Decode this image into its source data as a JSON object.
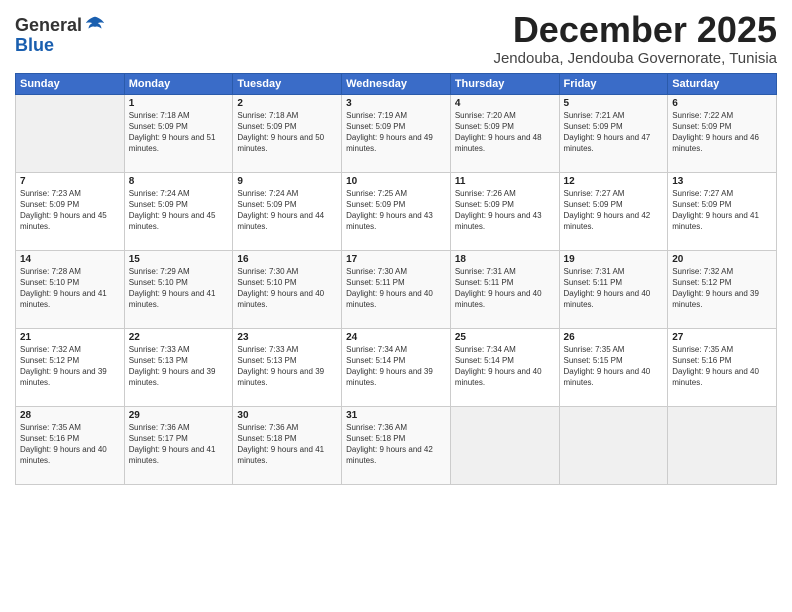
{
  "header": {
    "logo_general": "General",
    "logo_blue": "Blue",
    "month_title": "December 2025",
    "location": "Jendouba, Jendouba Governorate, Tunisia"
  },
  "days_of_week": [
    "Sunday",
    "Monday",
    "Tuesday",
    "Wednesday",
    "Thursday",
    "Friday",
    "Saturday"
  ],
  "weeks": [
    [
      {
        "day": "",
        "sunrise": "",
        "sunset": "",
        "daylight": "",
        "empty": true
      },
      {
        "day": "1",
        "sunrise": "Sunrise: 7:18 AM",
        "sunset": "Sunset: 5:09 PM",
        "daylight": "Daylight: 9 hours and 51 minutes."
      },
      {
        "day": "2",
        "sunrise": "Sunrise: 7:18 AM",
        "sunset": "Sunset: 5:09 PM",
        "daylight": "Daylight: 9 hours and 50 minutes."
      },
      {
        "day": "3",
        "sunrise": "Sunrise: 7:19 AM",
        "sunset": "Sunset: 5:09 PM",
        "daylight": "Daylight: 9 hours and 49 minutes."
      },
      {
        "day": "4",
        "sunrise": "Sunrise: 7:20 AM",
        "sunset": "Sunset: 5:09 PM",
        "daylight": "Daylight: 9 hours and 48 minutes."
      },
      {
        "day": "5",
        "sunrise": "Sunrise: 7:21 AM",
        "sunset": "Sunset: 5:09 PM",
        "daylight": "Daylight: 9 hours and 47 minutes."
      },
      {
        "day": "6",
        "sunrise": "Sunrise: 7:22 AM",
        "sunset": "Sunset: 5:09 PM",
        "daylight": "Daylight: 9 hours and 46 minutes."
      }
    ],
    [
      {
        "day": "7",
        "sunrise": "Sunrise: 7:23 AM",
        "sunset": "Sunset: 5:09 PM",
        "daylight": "Daylight: 9 hours and 45 minutes."
      },
      {
        "day": "8",
        "sunrise": "Sunrise: 7:24 AM",
        "sunset": "Sunset: 5:09 PM",
        "daylight": "Daylight: 9 hours and 45 minutes."
      },
      {
        "day": "9",
        "sunrise": "Sunrise: 7:24 AM",
        "sunset": "Sunset: 5:09 PM",
        "daylight": "Daylight: 9 hours and 44 minutes."
      },
      {
        "day": "10",
        "sunrise": "Sunrise: 7:25 AM",
        "sunset": "Sunset: 5:09 PM",
        "daylight": "Daylight: 9 hours and 43 minutes."
      },
      {
        "day": "11",
        "sunrise": "Sunrise: 7:26 AM",
        "sunset": "Sunset: 5:09 PM",
        "daylight": "Daylight: 9 hours and 43 minutes."
      },
      {
        "day": "12",
        "sunrise": "Sunrise: 7:27 AM",
        "sunset": "Sunset: 5:09 PM",
        "daylight": "Daylight: 9 hours and 42 minutes."
      },
      {
        "day": "13",
        "sunrise": "Sunrise: 7:27 AM",
        "sunset": "Sunset: 5:09 PM",
        "daylight": "Daylight: 9 hours and 41 minutes."
      }
    ],
    [
      {
        "day": "14",
        "sunrise": "Sunrise: 7:28 AM",
        "sunset": "Sunset: 5:10 PM",
        "daylight": "Daylight: 9 hours and 41 minutes."
      },
      {
        "day": "15",
        "sunrise": "Sunrise: 7:29 AM",
        "sunset": "Sunset: 5:10 PM",
        "daylight": "Daylight: 9 hours and 41 minutes."
      },
      {
        "day": "16",
        "sunrise": "Sunrise: 7:30 AM",
        "sunset": "Sunset: 5:10 PM",
        "daylight": "Daylight: 9 hours and 40 minutes."
      },
      {
        "day": "17",
        "sunrise": "Sunrise: 7:30 AM",
        "sunset": "Sunset: 5:11 PM",
        "daylight": "Daylight: 9 hours and 40 minutes."
      },
      {
        "day": "18",
        "sunrise": "Sunrise: 7:31 AM",
        "sunset": "Sunset: 5:11 PM",
        "daylight": "Daylight: 9 hours and 40 minutes."
      },
      {
        "day": "19",
        "sunrise": "Sunrise: 7:31 AM",
        "sunset": "Sunset: 5:11 PM",
        "daylight": "Daylight: 9 hours and 40 minutes."
      },
      {
        "day": "20",
        "sunrise": "Sunrise: 7:32 AM",
        "sunset": "Sunset: 5:12 PM",
        "daylight": "Daylight: 9 hours and 39 minutes."
      }
    ],
    [
      {
        "day": "21",
        "sunrise": "Sunrise: 7:32 AM",
        "sunset": "Sunset: 5:12 PM",
        "daylight": "Daylight: 9 hours and 39 minutes."
      },
      {
        "day": "22",
        "sunrise": "Sunrise: 7:33 AM",
        "sunset": "Sunset: 5:13 PM",
        "daylight": "Daylight: 9 hours and 39 minutes."
      },
      {
        "day": "23",
        "sunrise": "Sunrise: 7:33 AM",
        "sunset": "Sunset: 5:13 PM",
        "daylight": "Daylight: 9 hours and 39 minutes."
      },
      {
        "day": "24",
        "sunrise": "Sunrise: 7:34 AM",
        "sunset": "Sunset: 5:14 PM",
        "daylight": "Daylight: 9 hours and 39 minutes."
      },
      {
        "day": "25",
        "sunrise": "Sunrise: 7:34 AM",
        "sunset": "Sunset: 5:14 PM",
        "daylight": "Daylight: 9 hours and 40 minutes."
      },
      {
        "day": "26",
        "sunrise": "Sunrise: 7:35 AM",
        "sunset": "Sunset: 5:15 PM",
        "daylight": "Daylight: 9 hours and 40 minutes."
      },
      {
        "day": "27",
        "sunrise": "Sunrise: 7:35 AM",
        "sunset": "Sunset: 5:16 PM",
        "daylight": "Daylight: 9 hours and 40 minutes."
      }
    ],
    [
      {
        "day": "28",
        "sunrise": "Sunrise: 7:35 AM",
        "sunset": "Sunset: 5:16 PM",
        "daylight": "Daylight: 9 hours and 40 minutes."
      },
      {
        "day": "29",
        "sunrise": "Sunrise: 7:36 AM",
        "sunset": "Sunset: 5:17 PM",
        "daylight": "Daylight: 9 hours and 41 minutes."
      },
      {
        "day": "30",
        "sunrise": "Sunrise: 7:36 AM",
        "sunset": "Sunset: 5:18 PM",
        "daylight": "Daylight: 9 hours and 41 minutes."
      },
      {
        "day": "31",
        "sunrise": "Sunrise: 7:36 AM",
        "sunset": "Sunset: 5:18 PM",
        "daylight": "Daylight: 9 hours and 42 minutes."
      },
      {
        "day": "",
        "sunrise": "",
        "sunset": "",
        "daylight": "",
        "empty": true
      },
      {
        "day": "",
        "sunrise": "",
        "sunset": "",
        "daylight": "",
        "empty": true
      },
      {
        "day": "",
        "sunrise": "",
        "sunset": "",
        "daylight": "",
        "empty": true
      }
    ]
  ]
}
